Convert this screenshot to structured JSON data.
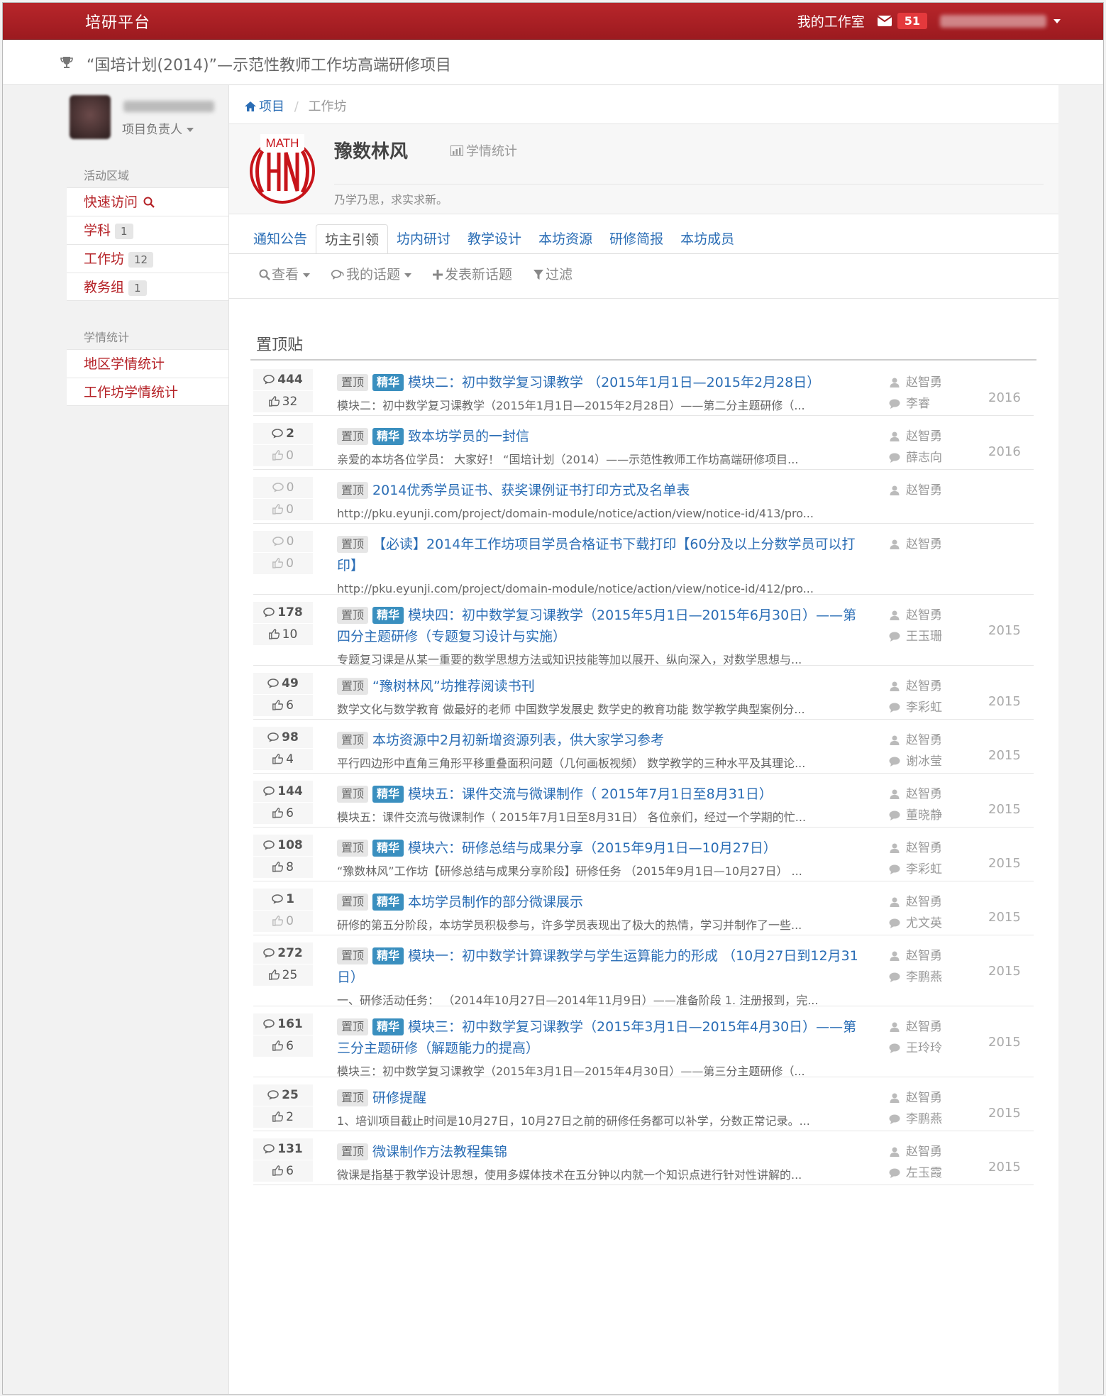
{
  "topbar": {
    "brand": "培研平台",
    "workroom": "我的工作室",
    "mail_count": "51"
  },
  "project": {
    "title": "“国培计划(2014)”—示范性教师工作坊高端研修项目"
  },
  "sidebar": {
    "role": "项目负责人",
    "sections": [
      {
        "head": "活动区域",
        "items": [
          {
            "label": "快速访问",
            "count": ""
          },
          {
            "label": "学科",
            "count": "1"
          },
          {
            "label": "工作坊",
            "count": "12"
          },
          {
            "label": "教务组",
            "count": "1"
          }
        ]
      },
      {
        "head": "学情统计",
        "items": [
          {
            "label": "地区学情统计",
            "count": ""
          },
          {
            "label": "工作坊学情统计",
            "count": ""
          }
        ]
      }
    ]
  },
  "breadcrumb": {
    "home": "项目",
    "current": "工作坊"
  },
  "workshop": {
    "logo_text": "MATH",
    "name": "豫数林风",
    "stats_link": "学情统计",
    "motto": "乃学乃思，求实求新。"
  },
  "tabs": [
    "通知公告",
    "坊主引领",
    "坊内研讨",
    "教学设计",
    "本坊资源",
    "研修简报",
    "本坊成员"
  ],
  "active_tab": 1,
  "toolbar": {
    "view": "查看",
    "my_topics": "我的话题",
    "new_topic": "发表新话题",
    "filter": "过滤"
  },
  "section_title": "置顶贴",
  "tag_labels": {
    "top": "置顶",
    "best": "精华"
  },
  "posts": [
    {
      "replies": "444",
      "likes": "32",
      "best": true,
      "title": "模块二：初中数学复习课教学 （2015年1月1日—2015年2月28日）",
      "excerpt": "模块二：初中数学复习课教学（2015年1月1日—2015年2月28日）——第二分主题研修（...",
      "author": "赵智勇",
      "last": "李睿",
      "year": "2016",
      "lines": 1
    },
    {
      "replies": "2",
      "likes": "0",
      "best": true,
      "title": "致本坊学员的一封信",
      "excerpt": "亲爱的本坊各位学员： 大家好！ “国培计划（2014）——示范性教师工作坊高端研修项目...",
      "author": "赵智勇",
      "last": "薛志向",
      "year": "2016",
      "lines": 1
    },
    {
      "replies": "0",
      "likes": "0",
      "best": false,
      "title": "2014优秀学员证书、获奖课例证书打印方式及名单表",
      "excerpt": "http://pku.eyunji.com/project/domain-module/notice/action/view/notice-id/413/pro...",
      "author": "赵智勇",
      "last": "",
      "year": "",
      "lines": 1
    },
    {
      "replies": "0",
      "likes": "0",
      "best": false,
      "title": "【必读】2014年工作坊项目学员合格证书下载打印【60分及以上分数学员可以打印】",
      "excerpt": "http://pku.eyunji.com/project/domain-module/notice/action/view/notice-id/412/pro...",
      "author": "赵智勇",
      "last": "",
      "year": "",
      "lines": 2
    },
    {
      "replies": "178",
      "likes": "10",
      "best": true,
      "title": "模块四：初中数学复习课教学（2015年5月1日—2015年6月30日）——第四分主题研修（专题复习设计与实施）",
      "excerpt": "专题复习课是从某一重要的数学思想方法或知识技能等加以展开、纵向深入，对数学思想与...",
      "author": "赵智勇",
      "last": "王玉珊",
      "year": "2015",
      "lines": 2
    },
    {
      "replies": "49",
      "likes": "6",
      "best": false,
      "title": "“豫树林风”坊推荐阅读书刊",
      "excerpt": "数学文化与数学教育 做最好的老师 中国数学发展史 数学史的教育功能 数学教学典型案例分...",
      "author": "赵智勇",
      "last": "李彩虹",
      "year": "2015",
      "lines": 1
    },
    {
      "replies": "98",
      "likes": "4",
      "best": false,
      "title": "本坊资源中2月初新增资源列表，供大家学习参考",
      "excerpt": "平行四边形中直角三角形平移重叠面积问题（几何画板视频） 数学教学的三种水平及其理论...",
      "author": "赵智勇",
      "last": "谢冰莹",
      "year": "2015",
      "lines": 1
    },
    {
      "replies": "144",
      "likes": "6",
      "best": true,
      "title": "模块五：课件交流与微课制作（ 2015年7月1日至8月31日）",
      "excerpt": "模块五：课件交流与微课制作（ 2015年7月1日至8月31日） 各位亲们，经过一个学期的忙...",
      "author": "赵智勇",
      "last": "董晓静",
      "year": "2015",
      "lines": 1
    },
    {
      "replies": "108",
      "likes": "8",
      "best": true,
      "title": "模块六：研修总结与成果分享（2015年9月1日—10月27日）",
      "excerpt": "“豫数林风”工作坊【研修总结与成果分享阶段】研修任务 （2015年9月1日—10月27日） ...",
      "author": "赵智勇",
      "last": "李彩虹",
      "year": "2015",
      "lines": 1
    },
    {
      "replies": "1",
      "likes": "0",
      "best": true,
      "title": "本坊学员制作的部分微课展示",
      "excerpt": "研修的第五分阶段，本坊学员积极参与，许多学员表现出了极大的热情，学习并制作了一些...",
      "author": "赵智勇",
      "last": "尤文英",
      "year": "2015",
      "lines": 1
    },
    {
      "replies": "272",
      "likes": "25",
      "best": true,
      "title": "模块一：初中数学计算课教学与学生运算能力的形成 （10月27日到12月31日）",
      "excerpt": "一、研修活动任务： （2014年10月27日—2014年11月9日）——准备阶段 1. 注册报到，完...",
      "author": "赵智勇",
      "last": "李鹏燕",
      "year": "2015",
      "lines": 2
    },
    {
      "replies": "161",
      "likes": "6",
      "best": true,
      "title": "模块三：初中数学复习课教学（2015年3月1日—2015年4月30日）——第三分主题研修（解题能力的提高）",
      "excerpt": "模块三：初中数学复习课教学（2015年3月1日—2015年4月30日）——第三分主题研修（...",
      "author": "赵智勇",
      "last": "王玲玲",
      "year": "2015",
      "lines": 2
    },
    {
      "replies": "25",
      "likes": "2",
      "best": false,
      "title": "研修提醒",
      "excerpt": "1、培训项目截止时间是10月27日，10月27日之前的研修任务都可以补学，分数正常记录。...",
      "author": "赵智勇",
      "last": "李鹏燕",
      "year": "2015",
      "lines": 1
    },
    {
      "replies": "131",
      "likes": "6",
      "best": false,
      "title": "微课制作方法教程集锦",
      "excerpt": "微课是指基于教学设计思想，使用多媒体技术在五分钟以内就一个知识点进行针对性讲解的...",
      "author": "赵智勇",
      "last": "左玉霞",
      "year": "2015",
      "lines": 1
    }
  ]
}
